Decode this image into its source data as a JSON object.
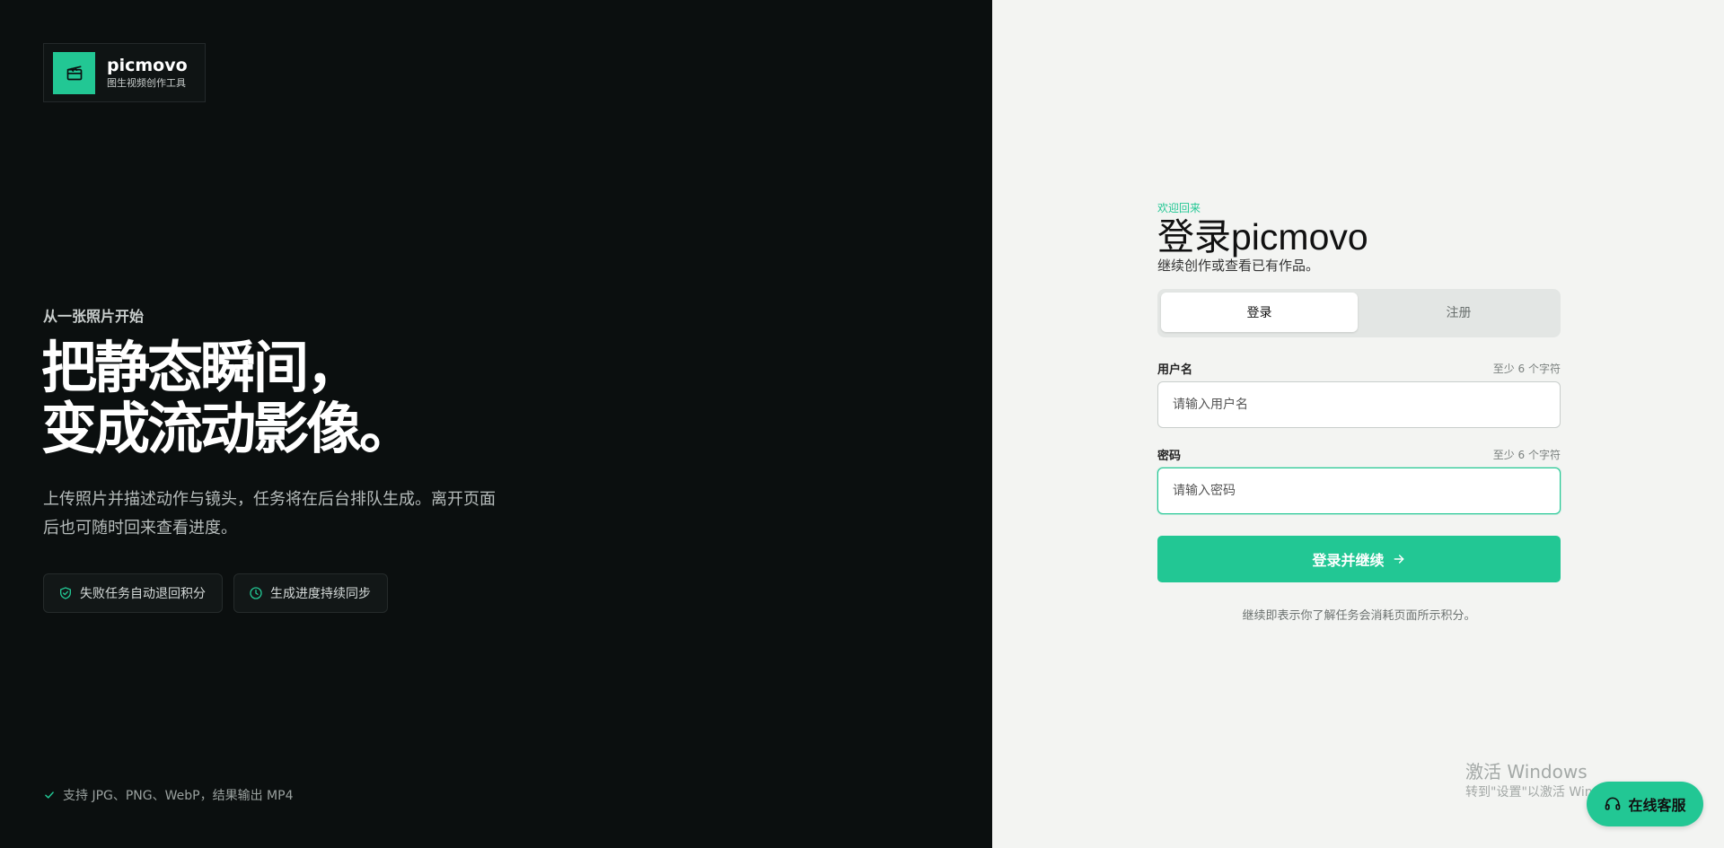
{
  "brand": {
    "name": "picmovo",
    "subtitle": "图生视频创作工具",
    "icon": "clapperboard-icon",
    "accent": "#22c794"
  },
  "hero": {
    "eyebrow": "从一张照片开始",
    "headline_line1": "把静态瞬间，",
    "headline_line2": "变成流动影像。",
    "description": "上传照片并描述动作与镜头，任务将在后台排队生成。离开页面后也可随时回来查看进度。",
    "chips": [
      {
        "label": "失败任务自动退回积分",
        "icon": "shield-check-icon"
      },
      {
        "label": "生成进度持续同步",
        "icon": "clock-icon"
      }
    ],
    "footnote": "支持 JPG、PNG、WebP，结果输出 MP4"
  },
  "form": {
    "welcome": "欢迎回来",
    "title": "登录picmovo",
    "subtitle": "继续创作或查看已有作品。",
    "tabs": {
      "login": "登录",
      "register": "注册"
    },
    "username": {
      "label": "用户名",
      "hint": "至少 6 个字符",
      "placeholder": "请输入用户名",
      "value": ""
    },
    "password": {
      "label": "密码",
      "hint": "至少 6 个字符",
      "placeholder": "请输入密码",
      "value": ""
    },
    "submit_label": "登录并继续",
    "terms": "继续即表示你了解任务会消耗页面所示积分。"
  },
  "watermark": {
    "line1": "激活 Windows",
    "line2": "转到\"设置\"以激活 Windows。"
  },
  "support": {
    "label": "在线客服",
    "icon": "headset-icon"
  }
}
